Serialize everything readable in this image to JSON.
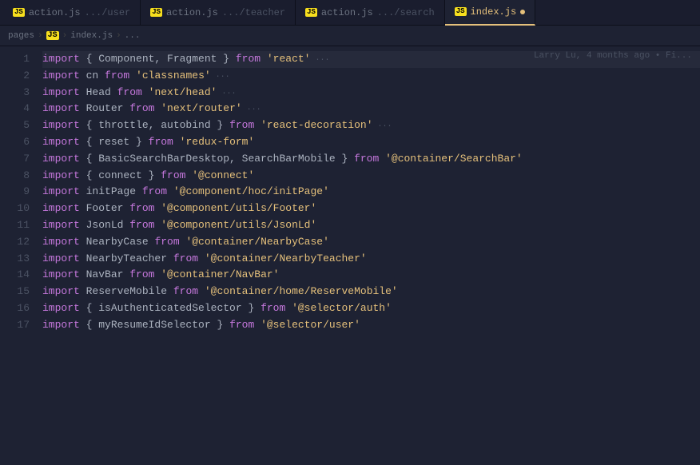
{
  "tabs": [
    {
      "id": "tab-action-user",
      "icon": "JS",
      "label": "action.js",
      "path": ".../user",
      "active": false
    },
    {
      "id": "tab-action-teacher",
      "icon": "JS",
      "label": "action.js",
      "path": ".../teacher",
      "active": false
    },
    {
      "id": "tab-action-search",
      "icon": "JS",
      "label": "action.js",
      "path": ".../search",
      "active": false
    },
    {
      "id": "tab-index",
      "icon": "JS",
      "label": "index.js",
      "path": "",
      "active": true,
      "dot": true
    }
  ],
  "breadcrumb": {
    "parts": [
      "pages",
      "JS",
      "index.js",
      "..."
    ]
  },
  "blame": "Larry Lu, 4 months ago • Fi...",
  "lines": [
    {
      "num": 1,
      "tokens": [
        {
          "t": "kw",
          "v": "import"
        },
        {
          "t": "punct",
          "v": " { "
        },
        {
          "t": "id",
          "v": "Component, Fragment"
        },
        {
          "t": "punct",
          "v": " } "
        },
        {
          "t": "kw",
          "v": "from"
        },
        {
          "t": "str",
          "v": " 'react'"
        },
        {
          "t": "dots",
          "v": "  ..."
        }
      ]
    },
    {
      "num": 2,
      "tokens": [
        {
          "t": "kw",
          "v": "import"
        },
        {
          "t": "id",
          "v": " cn "
        },
        {
          "t": "kw",
          "v": "from"
        },
        {
          "t": "str",
          "v": " 'classnames'"
        },
        {
          "t": "dots",
          "v": "  ..."
        }
      ]
    },
    {
      "num": 3,
      "tokens": [
        {
          "t": "kw",
          "v": "import"
        },
        {
          "t": "id",
          "v": " Head "
        },
        {
          "t": "kw",
          "v": "from"
        },
        {
          "t": "str",
          "v": " 'next/head'"
        },
        {
          "t": "dots",
          "v": "  ..."
        }
      ]
    },
    {
      "num": 4,
      "tokens": [
        {
          "t": "kw",
          "v": "import"
        },
        {
          "t": "id",
          "v": " Router "
        },
        {
          "t": "kw",
          "v": "from"
        },
        {
          "t": "str",
          "v": " 'next/router'"
        },
        {
          "t": "dots",
          "v": "  ..."
        }
      ]
    },
    {
      "num": 5,
      "tokens": [
        {
          "t": "kw",
          "v": "import"
        },
        {
          "t": "punct",
          "v": " { "
        },
        {
          "t": "id",
          "v": "throttle, autobind"
        },
        {
          "t": "punct",
          "v": " } "
        },
        {
          "t": "kw",
          "v": "from"
        },
        {
          "t": "str",
          "v": " 'react-decoration'"
        },
        {
          "t": "dots",
          "v": "  ..."
        }
      ]
    },
    {
      "num": 6,
      "tokens": [
        {
          "t": "kw",
          "v": "import"
        },
        {
          "t": "punct",
          "v": " { "
        },
        {
          "t": "id",
          "v": "reset"
        },
        {
          "t": "punct",
          "v": " } "
        },
        {
          "t": "kw",
          "v": "from"
        },
        {
          "t": "str",
          "v": " 'redux-form'"
        }
      ]
    },
    {
      "num": 7,
      "tokens": [
        {
          "t": "kw",
          "v": "import"
        },
        {
          "t": "punct",
          "v": " { "
        },
        {
          "t": "id",
          "v": "BasicSearchBarDesktop, SearchBarMobile"
        },
        {
          "t": "punct",
          "v": " } "
        },
        {
          "t": "kw",
          "v": "from"
        },
        {
          "t": "str",
          "v": " '@container/SearchBar'"
        }
      ]
    },
    {
      "num": 8,
      "tokens": [
        {
          "t": "kw",
          "v": "import"
        },
        {
          "t": "punct",
          "v": " { "
        },
        {
          "t": "id",
          "v": "connect"
        },
        {
          "t": "punct",
          "v": " } "
        },
        {
          "t": "kw",
          "v": "from"
        },
        {
          "t": "str",
          "v": " '@connect'"
        }
      ]
    },
    {
      "num": 9,
      "tokens": [
        {
          "t": "kw",
          "v": "import"
        },
        {
          "t": "id",
          "v": " initPage "
        },
        {
          "t": "kw",
          "v": "from"
        },
        {
          "t": "str",
          "v": " '@component/hoc/initPage'"
        }
      ]
    },
    {
      "num": 10,
      "tokens": [
        {
          "t": "kw",
          "v": "import"
        },
        {
          "t": "id",
          "v": " Footer "
        },
        {
          "t": "kw",
          "v": "from"
        },
        {
          "t": "str",
          "v": " '@component/utils/Footer'"
        }
      ]
    },
    {
      "num": 11,
      "tokens": [
        {
          "t": "kw",
          "v": "import"
        },
        {
          "t": "id",
          "v": " JsonLd "
        },
        {
          "t": "kw",
          "v": "from"
        },
        {
          "t": "str",
          "v": " '@component/utils/JsonLd'"
        }
      ]
    },
    {
      "num": 12,
      "tokens": [
        {
          "t": "kw",
          "v": "import"
        },
        {
          "t": "id",
          "v": " NearbyCase "
        },
        {
          "t": "kw",
          "v": "from"
        },
        {
          "t": "str",
          "v": " '@container/NearbyCase'"
        }
      ]
    },
    {
      "num": 13,
      "tokens": [
        {
          "t": "kw",
          "v": "import"
        },
        {
          "t": "id",
          "v": " NearbyTeacher "
        },
        {
          "t": "kw",
          "v": "from"
        },
        {
          "t": "str",
          "v": " '@container/NearbyTeacher'"
        }
      ]
    },
    {
      "num": 14,
      "tokens": [
        {
          "t": "kw",
          "v": "import"
        },
        {
          "t": "id",
          "v": " NavBar "
        },
        {
          "t": "kw",
          "v": "from"
        },
        {
          "t": "str",
          "v": " '@container/NavBar'"
        }
      ]
    },
    {
      "num": 15,
      "tokens": [
        {
          "t": "kw",
          "v": "import"
        },
        {
          "t": "id",
          "v": " ReserveMobile "
        },
        {
          "t": "kw",
          "v": "from"
        },
        {
          "t": "str",
          "v": " '@container/home/ReserveMobile'"
        }
      ]
    },
    {
      "num": 16,
      "tokens": [
        {
          "t": "kw",
          "v": "import"
        },
        {
          "t": "punct",
          "v": " { "
        },
        {
          "t": "id",
          "v": "isAuthenticatedSelector"
        },
        {
          "t": "punct",
          "v": " } "
        },
        {
          "t": "kw",
          "v": "from"
        },
        {
          "t": "str",
          "v": " '@selector/auth'"
        }
      ]
    },
    {
      "num": 17,
      "tokens": [
        {
          "t": "kw",
          "v": "import"
        },
        {
          "t": "punct",
          "v": " { "
        },
        {
          "t": "id",
          "v": "myResumeIdSelector"
        },
        {
          "t": "punct",
          "v": " } "
        },
        {
          "t": "kw",
          "v": "from"
        },
        {
          "t": "str",
          "v": " '@selector/user'"
        }
      ]
    }
  ]
}
